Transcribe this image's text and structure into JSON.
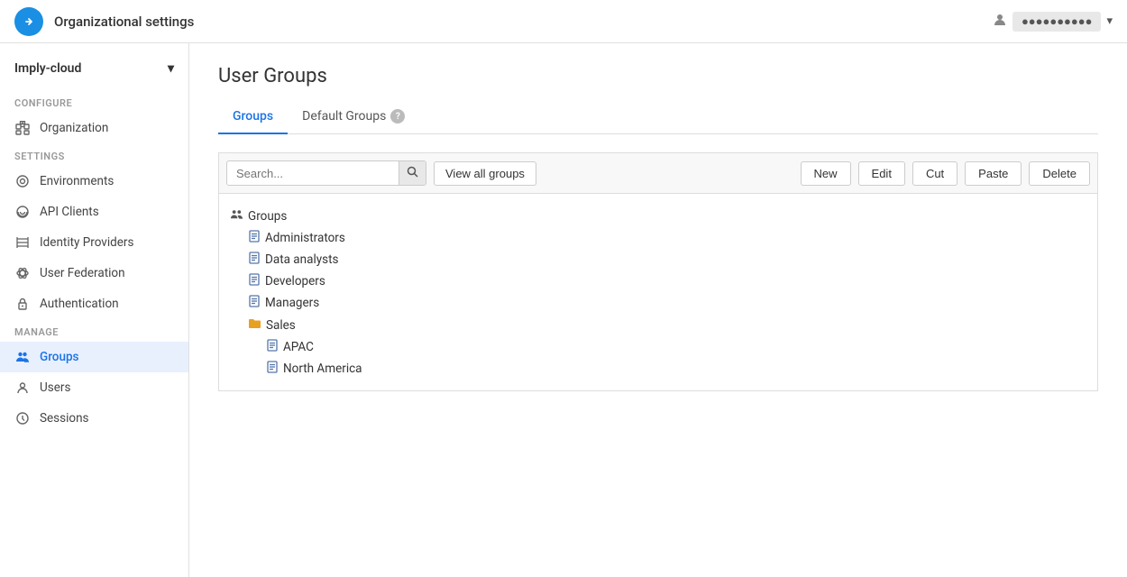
{
  "topbar": {
    "logo_letter": "→",
    "title": "Organizational settings",
    "user_name": "●●●●●●●●●●"
  },
  "sidebar": {
    "org_name": "Imply-cloud",
    "sections": [
      {
        "label": "Configure",
        "items": [
          {
            "id": "organization",
            "label": "Organization",
            "icon": "org"
          },
          {
            "id": "environments",
            "label": "Environments",
            "icon": "env"
          },
          {
            "id": "api-clients",
            "label": "API Clients",
            "icon": "api"
          },
          {
            "id": "identity-providers",
            "label": "Identity Providers",
            "icon": "idp"
          },
          {
            "id": "user-federation",
            "label": "User Federation",
            "icon": "fed"
          },
          {
            "id": "authentication",
            "label": "Authentication",
            "icon": "auth"
          }
        ]
      },
      {
        "label": "Manage",
        "items": [
          {
            "id": "groups",
            "label": "Groups",
            "icon": "groups",
            "active": true
          },
          {
            "id": "users",
            "label": "Users",
            "icon": "users"
          },
          {
            "id": "sessions",
            "label": "Sessions",
            "icon": "sessions"
          }
        ]
      }
    ]
  },
  "page": {
    "title": "User Groups",
    "tabs": [
      {
        "id": "groups",
        "label": "Groups",
        "active": true,
        "help": false
      },
      {
        "id": "default-groups",
        "label": "Default Groups",
        "active": false,
        "help": true
      }
    ]
  },
  "toolbar": {
    "search_placeholder": "Search...",
    "view_all_label": "View all groups",
    "buttons": [
      {
        "id": "new",
        "label": "New"
      },
      {
        "id": "edit",
        "label": "Edit"
      },
      {
        "id": "cut",
        "label": "Cut"
      },
      {
        "id": "paste",
        "label": "Paste"
      },
      {
        "id": "delete",
        "label": "Delete"
      }
    ]
  },
  "tree": {
    "root_label": "Groups",
    "children": [
      {
        "id": "administrators",
        "label": "Administrators",
        "type": "doc",
        "children": []
      },
      {
        "id": "data-analysts",
        "label": "Data analysts",
        "type": "doc",
        "children": []
      },
      {
        "id": "developers",
        "label": "Developers",
        "type": "doc",
        "children": []
      },
      {
        "id": "managers",
        "label": "Managers",
        "type": "doc",
        "children": []
      },
      {
        "id": "sales",
        "label": "Sales",
        "type": "folder",
        "expanded": true,
        "children": [
          {
            "id": "apac",
            "label": "APAC",
            "type": "doc",
            "children": []
          },
          {
            "id": "north-america",
            "label": "North America",
            "type": "doc",
            "children": []
          }
        ]
      }
    ]
  }
}
